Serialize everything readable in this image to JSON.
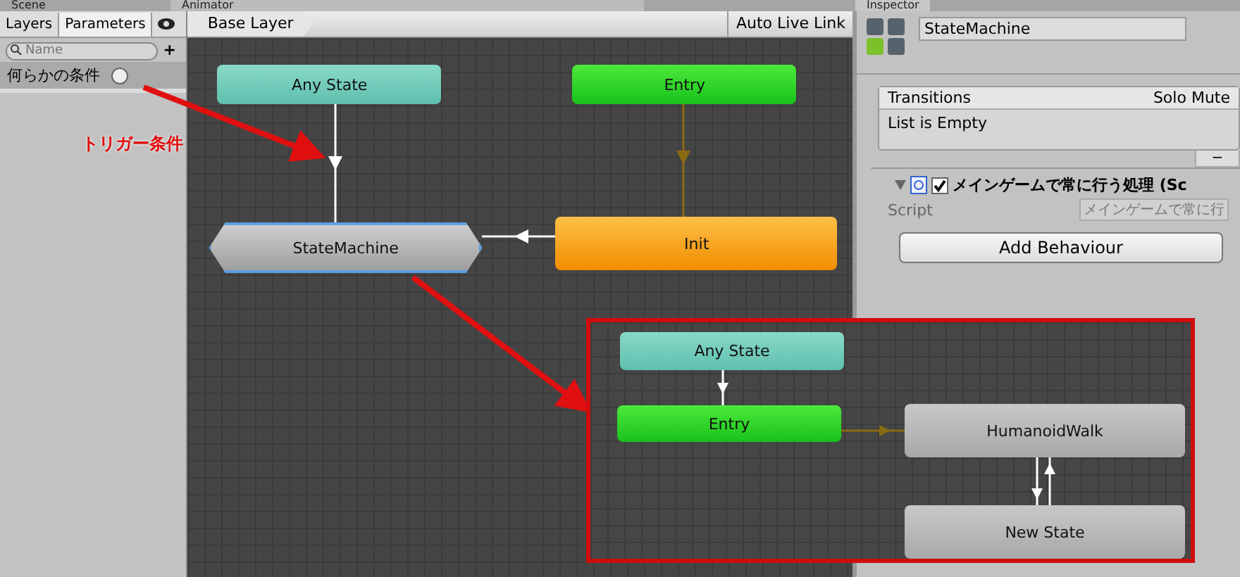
{
  "window_tabs": [
    {
      "label": "Scene"
    },
    {
      "label": "Animator"
    },
    {
      "label": "Inspector"
    }
  ],
  "left_panel": {
    "tabs": [
      {
        "label": "Layers",
        "selected": false
      },
      {
        "label": "Parameters",
        "selected": true
      }
    ],
    "search": {
      "placeholder": "Name"
    },
    "add_button": "+",
    "parameters": [
      {
        "name": "何らかの条件",
        "kind": "trigger",
        "on": false
      }
    ]
  },
  "toolbar": {
    "breadcrumb": "Base Layer",
    "auto_live_link": "Auto Live Link"
  },
  "graph": {
    "nodes": [
      {
        "label": "Any State",
        "kind": "any"
      },
      {
        "label": "Entry",
        "kind": "entry"
      },
      {
        "label": "StateMachine",
        "kind": "machine",
        "selected": true
      },
      {
        "label": "Init",
        "kind": "default",
        "selected": false
      }
    ]
  },
  "annotation": {
    "text": "トリガー条件"
  },
  "inset": {
    "nodes": [
      {
        "label": "Any State",
        "kind": "any"
      },
      {
        "label": "Entry",
        "kind": "entry"
      },
      {
        "label": "HumanoidWalk",
        "kind": "state"
      },
      {
        "label": "New State",
        "kind": "state"
      }
    ]
  },
  "inspector": {
    "name": "StateMachine",
    "transitions": {
      "title": "Transitions",
      "solo": "Solo",
      "mute": "Mute",
      "empty": "List is Empty",
      "remove": "−"
    },
    "component": {
      "expanded": true,
      "enabled": true,
      "title": "メインゲームで常に行う処理 (Sc",
      "script_label": "Script",
      "script_value": "メインゲームで常に行"
    },
    "add_button": "Add Behaviour"
  }
}
